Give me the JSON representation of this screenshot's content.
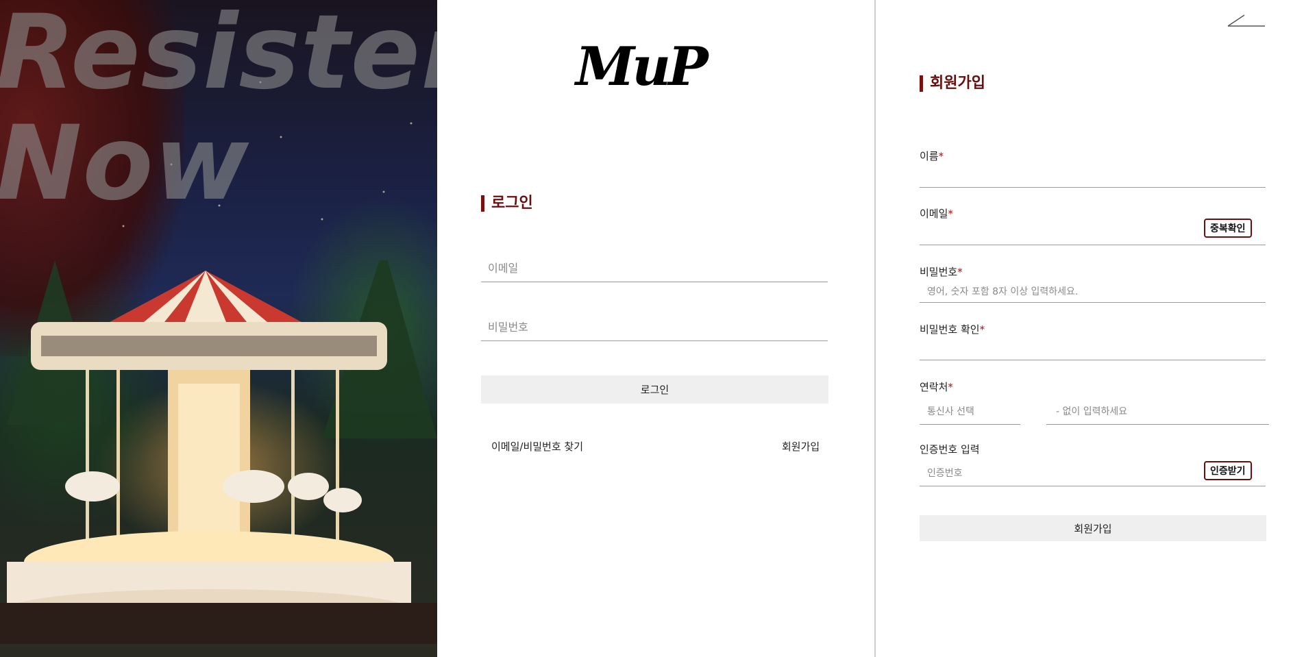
{
  "hero": {
    "title_line1": "Resister",
    "title_line2": "Now"
  },
  "logo": "MuP",
  "login": {
    "title": "로그인",
    "email_placeholder": "이메일",
    "password_placeholder": "비밀번호",
    "submit_label": "로그인",
    "find_link": "이메일/비밀번호 찾기",
    "join_link": "회원가입"
  },
  "register": {
    "title": "회원가입",
    "required_mark": "*",
    "name_label": "이름",
    "email_label": "이메일",
    "dup_check_label": "중복확인",
    "password_label": "비밀번호",
    "password_placeholder": "영어, 숫자 포함 8자 이상 입력하세요.",
    "password_confirm_label": "비밀번호 확인",
    "phone_label": "연락처",
    "carrier_placeholder": "통신사 선택",
    "phone_placeholder": "- 없이 입력하세요",
    "auth_label": "인증번호 입력",
    "auth_placeholder": "인증번호",
    "auth_button": "인증받기",
    "submit_label": "회원가입"
  },
  "colors": {
    "accent": "#6a0d0d",
    "required": "#cc0000",
    "button_bg": "#efefef"
  }
}
